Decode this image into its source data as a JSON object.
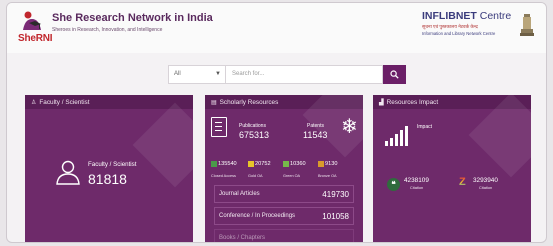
{
  "header": {
    "logo_text": "SheRNI",
    "title": "She Research Network in India",
    "tagline": "Sheroes in Research, Innovation, and Intelligence",
    "partner": {
      "name": "INFLIBNET",
      "name_suffix": "Centre",
      "hindi": "सूचना एवं पुस्तकालय नेटवर्क केन्द्र",
      "subtitle": "Information and Library Network Centre"
    }
  },
  "search": {
    "select_value": "All",
    "placeholder": "Search for..."
  },
  "panels": {
    "faculty": {
      "title": "Faculty / Scientist",
      "label": "Faculty / Scientist",
      "count": "81818"
    },
    "scholarly": {
      "title": "Scholarly Resources",
      "publications_label": "Publications",
      "publications_count": "675313",
      "patents_label": "Patents",
      "patents_count": "11543",
      "open_access": [
        {
          "value": "135540",
          "label": "Closed Access",
          "color": "#4b9a4a"
        },
        {
          "value": "20752",
          "label": "Gold OA",
          "color": "#e6c52a"
        },
        {
          "value": "10360",
          "label": "Green OA",
          "color": "#76b84a"
        },
        {
          "value": "9130",
          "label": "Bronze OA",
          "color": "#d99a2b"
        }
      ],
      "stats": [
        {
          "label": "Journal Articles",
          "value": "419730"
        },
        {
          "label": "Conference / In Proceedings",
          "value": "101058"
        },
        {
          "label": "Books / Chapters",
          "value": ""
        }
      ]
    },
    "impact": {
      "title": "Resources Impact",
      "impact_label": "Impact",
      "metrics": [
        {
          "value": "4238109",
          "label": "Citation"
        },
        {
          "value": "3293940",
          "label": "Citation"
        }
      ]
    }
  }
}
